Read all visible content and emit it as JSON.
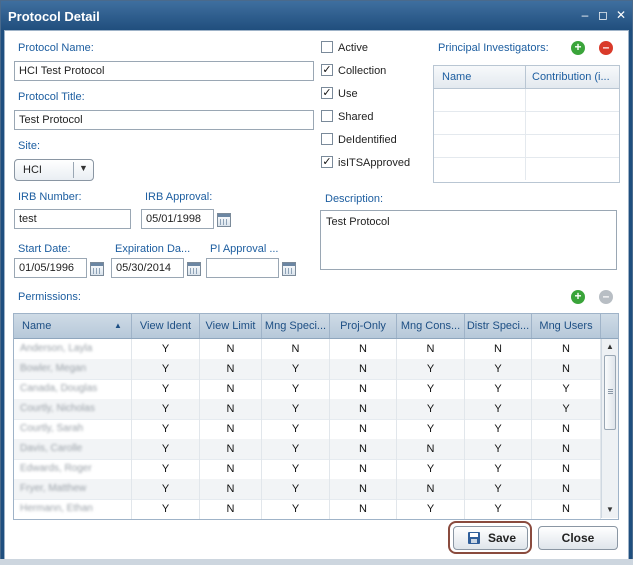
{
  "window": {
    "title": "Protocol Detail"
  },
  "form": {
    "protocol_name_label": "Protocol Name:",
    "protocol_name_value": "HCI Test Protocol",
    "protocol_title_label": "Protocol Title:",
    "protocol_title_value": "Test Protocol",
    "site_label": "Site:",
    "site_value": "HCI",
    "irb_number_label": "IRB Number:",
    "irb_number_value": "test",
    "irb_approval_label": "IRB Approval:",
    "irb_approval_value": "05/01/1998",
    "start_date_label": "Start Date:",
    "start_date_value": "01/05/1996",
    "expiration_label": "Expiration Da...",
    "expiration_value": "05/30/2014",
    "pi_approval_label": "PI Approval ...",
    "pi_approval_value": "",
    "description_label": "Description:",
    "description_value": "Test Protocol",
    "permissions_label": "Permissions:"
  },
  "checkboxes": [
    {
      "label": "Active",
      "checked": false
    },
    {
      "label": "Collection",
      "checked": true
    },
    {
      "label": "Use",
      "checked": true
    },
    {
      "label": "Shared",
      "checked": false
    },
    {
      "label": "DeIdentified",
      "checked": false
    },
    {
      "label": "isITSApproved",
      "checked": true
    }
  ],
  "principal_investigators": {
    "label": "Principal Investigators:",
    "columns": [
      "Name",
      "Contribution (i..."
    ]
  },
  "permissions_grid": {
    "columns": [
      "Name",
      "View Ident",
      "View Limit",
      "Mng Speci...",
      "Proj-Only",
      "Mng Cons...",
      "Distr Speci...",
      "Mng Users"
    ],
    "sort_indicator": "▲",
    "rows": [
      {
        "name": "Anderson, Layla",
        "v": [
          "Y",
          "N",
          "N",
          "N",
          "N",
          "N",
          "N"
        ]
      },
      {
        "name": "Bowler, Megan",
        "v": [
          "Y",
          "N",
          "Y",
          "N",
          "Y",
          "Y",
          "N"
        ]
      },
      {
        "name": "Canada, Douglas",
        "v": [
          "Y",
          "N",
          "Y",
          "N",
          "Y",
          "Y",
          "Y"
        ]
      },
      {
        "name": "Courtly, Nicholas",
        "v": [
          "Y",
          "N",
          "Y",
          "N",
          "Y",
          "Y",
          "Y"
        ]
      },
      {
        "name": "Courtly, Sarah",
        "v": [
          "Y",
          "N",
          "Y",
          "N",
          "Y",
          "Y",
          "N"
        ]
      },
      {
        "name": "Davis, Carolle",
        "v": [
          "Y",
          "N",
          "Y",
          "N",
          "N",
          "Y",
          "N"
        ]
      },
      {
        "name": "Edwards, Roger",
        "v": [
          "Y",
          "N",
          "Y",
          "N",
          "Y",
          "Y",
          "N"
        ]
      },
      {
        "name": "Fryer, Matthew",
        "v": [
          "Y",
          "N",
          "Y",
          "N",
          "N",
          "Y",
          "N"
        ]
      },
      {
        "name": "Hermann, Ethan",
        "v": [
          "Y",
          "N",
          "Y",
          "N",
          "Y",
          "Y",
          "N"
        ]
      }
    ]
  },
  "buttons": {
    "save": "Save",
    "close": "Close"
  },
  "icons": {
    "minimize": "minimize-icon",
    "maximize": "maximize-icon",
    "close": "close-icon",
    "add": "add-icon",
    "remove": "remove-icon",
    "calendar": "calendar-icon",
    "save": "floppy-disk-icon"
  },
  "colors": {
    "title_bar": "#1f4d7c",
    "label_blue": "#1d5ea0",
    "add_green": "#3aa43a",
    "remove_red": "#d93a2a"
  }
}
